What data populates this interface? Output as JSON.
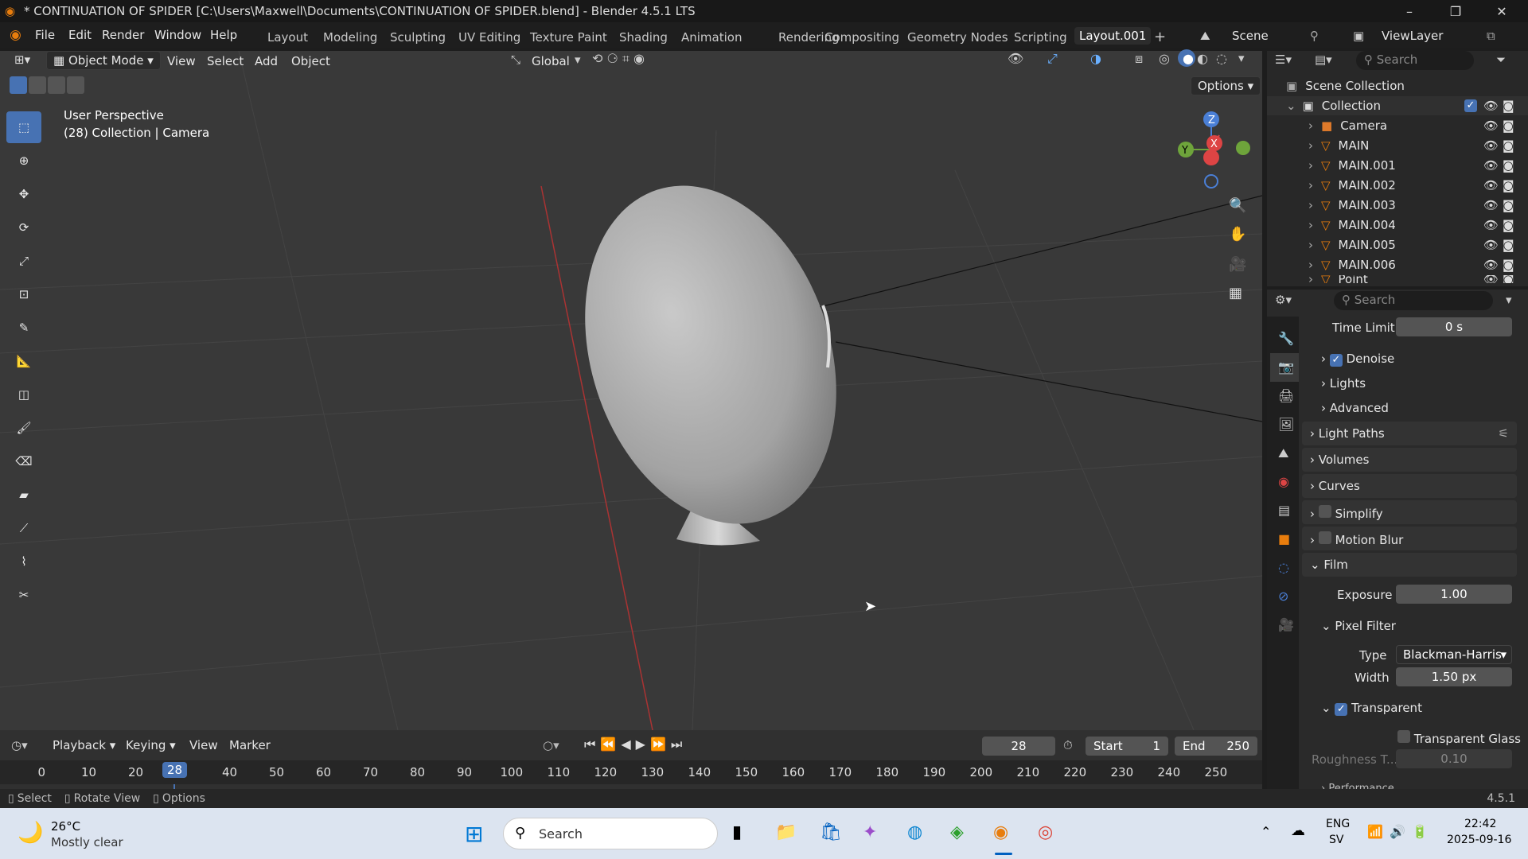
{
  "window": {
    "title": "* CONTINUATION OF SPIDER [C:\\Users\\Maxwell\\Documents\\CONTINUATION OF SPIDER.blend] - Blender 4.5.1 LTS",
    "minimize": "–",
    "maximize": "❐",
    "close": "✕"
  },
  "menu": [
    "File",
    "Edit",
    "Render",
    "Window",
    "Help"
  ],
  "workspaces": [
    "Layout",
    "Modeling",
    "Sculpting",
    "UV Editing",
    "Texture Paint",
    "Shading",
    "Animation",
    "Rendering",
    "Compositing",
    "Geometry Nodes",
    "Scripting",
    "Layout.001"
  ],
  "scene": {
    "label": "Scene",
    "viewlayer": "ViewLayer"
  },
  "viewport": {
    "mode": "Object Mode",
    "view": "View",
    "select": "Select",
    "add": "Add",
    "object": "Object",
    "orientation": "Global",
    "options": "Options",
    "info1": "User Perspective",
    "info2": "(28) Collection | Camera"
  },
  "gizmo": {
    "z": "Z",
    "y": "Y",
    "x": "X"
  },
  "outliner": {
    "search_placeholder": "Search",
    "scene_collection": "Scene Collection",
    "collection": "Collection",
    "items": [
      "Camera",
      "MAIN",
      "MAIN.001",
      "MAIN.002",
      "MAIN.003",
      "MAIN.004",
      "MAIN.005",
      "MAIN.006",
      "Point"
    ]
  },
  "props": {
    "search_placeholder": "Search",
    "time_limit_label": "Time Limit",
    "time_limit": "0 s",
    "denoise": "Denoise",
    "lights": "Lights",
    "advanced": "Advanced",
    "light_paths": "Light Paths",
    "volumes": "Volumes",
    "curves": "Curves",
    "simplify": "Simplify",
    "motion_blur": "Motion Blur",
    "film": "Film",
    "exposure_label": "Exposure",
    "exposure": "1.00",
    "pixel_filter": "Pixel Filter",
    "type_label": "Type",
    "type": "Blackman-Harris",
    "width_label": "Width",
    "width": "1.50 px",
    "transparent": "Transparent",
    "transparent_glass": "Transparent Glass",
    "roughness_label": "Roughness T...",
    "roughness": "0.10",
    "performance": "Performance"
  },
  "timeline": {
    "playback": "Playback",
    "keying": "Keying",
    "view": "View",
    "marker": "Marker",
    "current": "28",
    "start_label": "Start",
    "start": "1",
    "end_label": "End",
    "end": "250",
    "ticks": [
      "0",
      "10",
      "20",
      "40",
      "50",
      "60",
      "70",
      "80",
      "90",
      "100",
      "110",
      "120",
      "130",
      "140",
      "150",
      "160",
      "170",
      "180",
      "190",
      "200",
      "210",
      "220",
      "230",
      "240",
      "250"
    ],
    "frame_marker": "28"
  },
  "status": {
    "select": "Select",
    "rotate": "Rotate View",
    "options": "Options",
    "version": "4.5.1"
  },
  "taskbar": {
    "temp": "26°C",
    "weather": "Mostly clear",
    "search": "Search",
    "lang1": "ENG",
    "lang2": "SV",
    "time": "22:42",
    "date": "2025-09-16"
  }
}
